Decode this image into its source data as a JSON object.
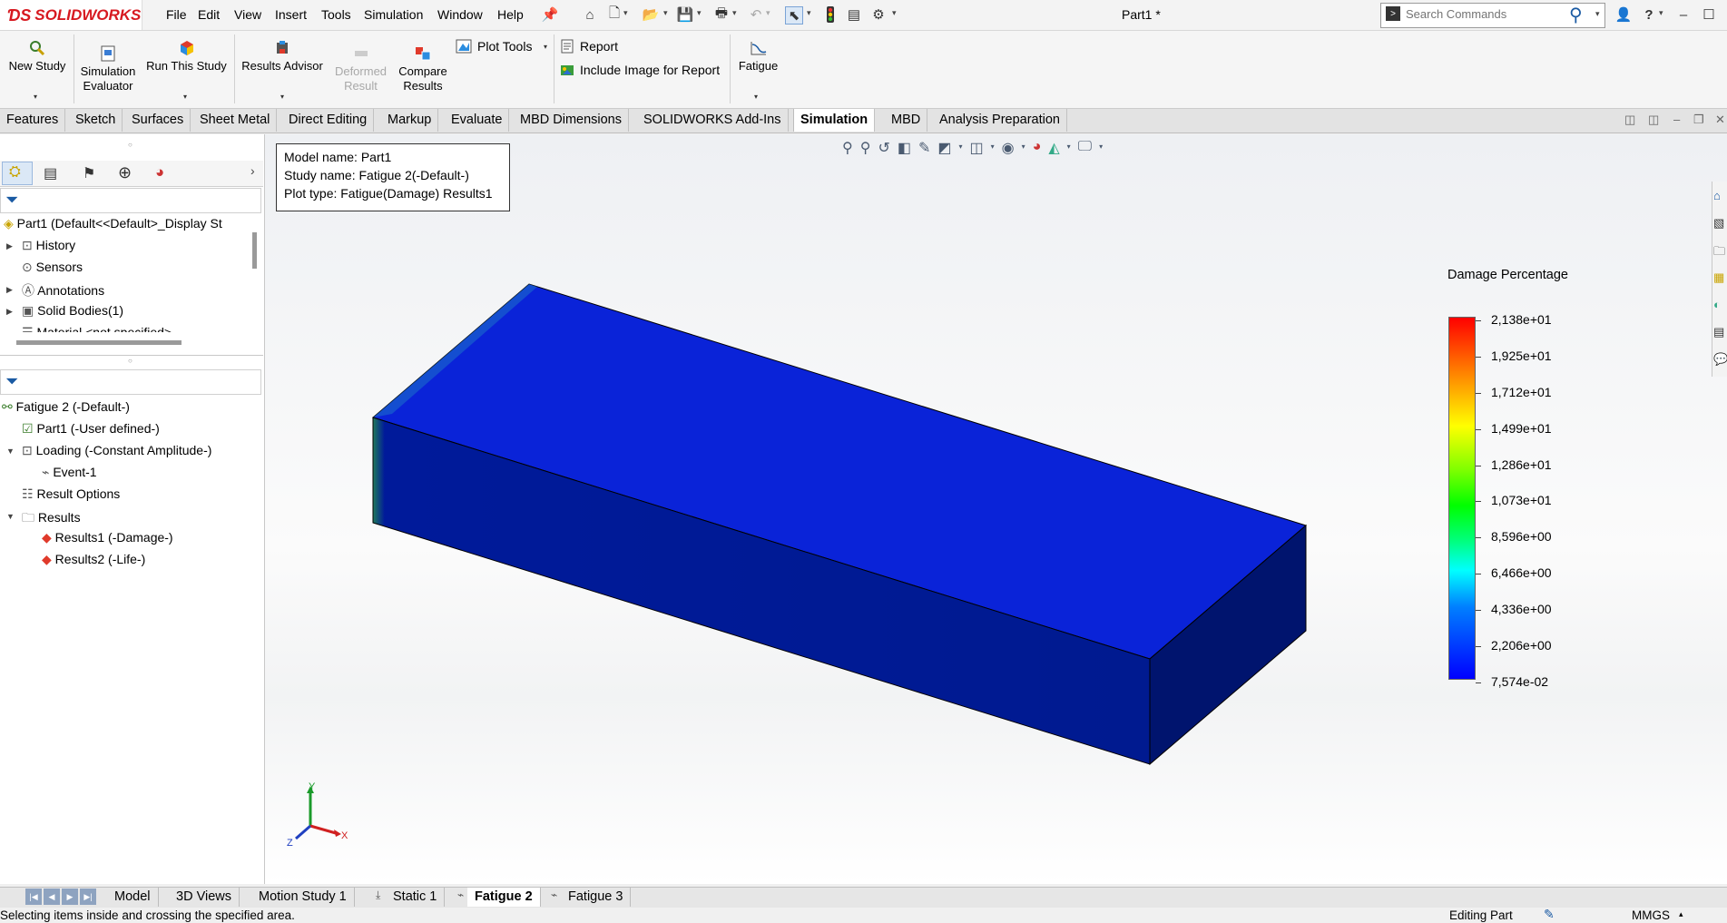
{
  "app": {
    "logo_text": "SOLIDWORKS",
    "doc_title": "Part1 *",
    "menus": [
      "File",
      "Edit",
      "View",
      "Insert",
      "Tools",
      "Simulation",
      "Window",
      "Help"
    ],
    "search_placeholder": "Search Commands"
  },
  "ribbon": {
    "new_study": "New Study",
    "sim_evaluator_1": "Simulation",
    "sim_evaluator_2": "Evaluator",
    "run_study": "Run This Study",
    "results_advisor": "Results Advisor",
    "deformed_1": "Deformed",
    "deformed_2": "Result",
    "compare_1": "Compare",
    "compare_2": "Results",
    "plot_tools": "Plot Tools",
    "report": "Report",
    "include_image": "Include Image for Report",
    "fatigue": "Fatigue"
  },
  "tabs": [
    "Features",
    "Sketch",
    "Surfaces",
    "Sheet Metal",
    "Direct Editing",
    "Markup",
    "Evaluate",
    "MBD Dimensions",
    "SOLIDWORKS Add-Ins",
    "Simulation",
    "MBD",
    "Analysis Preparation"
  ],
  "active_tab": "Simulation",
  "feature_tree": {
    "root": "Part1  (Default<<Default>_Display St",
    "items": [
      "History",
      "Sensors",
      "Annotations",
      "Solid Bodies(1)",
      "Material <not specified>"
    ]
  },
  "study_tree": {
    "study": "Fatigue 2 (-Default-)",
    "part": "Part1 (-User defined-)",
    "loading": "Loading (-Constant Amplitude-)",
    "event": "Event-1",
    "result_options": "Result Options",
    "results": "Results",
    "results1": "Results1 (-Damage-)",
    "results2": "Results2 (-Life-)"
  },
  "info": {
    "model": "Model name: Part1",
    "study": "Study name: Fatigue 2(-Default-)",
    "plot": "Plot type: Fatigue(Damage) Results1"
  },
  "legend": {
    "title": "Damage Percentage",
    "labels": [
      "2,138e+01",
      "1,925e+01",
      "1,712e+01",
      "1,499e+01",
      "1,286e+01",
      "1,073e+01",
      "8,596e+00",
      "6,466e+00",
      "4,336e+00",
      "2,206e+00",
      "7,574e-02"
    ]
  },
  "triad": {
    "x": "X",
    "y": "Y",
    "z": "Z"
  },
  "bottom_tabs": [
    "Model",
    "3D Views",
    "Motion Study 1",
    "Static 1",
    "Fatigue 2",
    "Fatigue 3"
  ],
  "active_bottom_tab": "Fatigue 2",
  "status": {
    "message": "Selecting items inside and crossing the specified area.",
    "mode": "Editing Part",
    "units": "MMGS"
  },
  "colors": {
    "brand": "#d71920",
    "part_top": "#0a23d8",
    "part_front": "#001a9a",
    "part_side": "#00146e"
  }
}
